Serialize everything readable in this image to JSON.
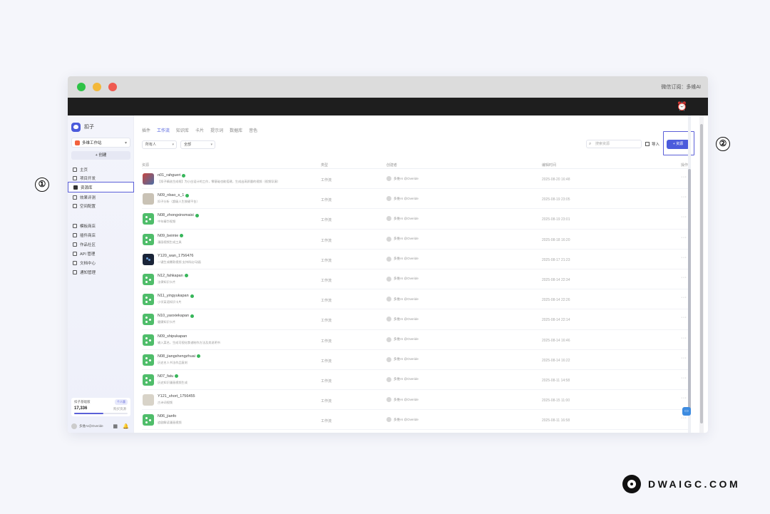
{
  "window": {
    "titlebar_right": "微信订阅：多维AI"
  },
  "sidebar": {
    "brand": "扣子",
    "workspace": "多维工作站",
    "create_label": "+ 创建",
    "items": [
      {
        "label": "主页",
        "icon": "home-icon"
      },
      {
        "label": "项目开发",
        "icon": "code-icon"
      },
      {
        "label": "资源库",
        "icon": "library-icon",
        "active": true
      },
      {
        "label": "效果评测",
        "icon": "chart-icon"
      },
      {
        "label": "空间配置",
        "icon": "settings-icon"
      },
      {
        "label": "模板商店",
        "icon": "template-icon"
      },
      {
        "label": "插件商店",
        "icon": "plugin-icon"
      },
      {
        "label": "作品社区",
        "icon": "community-icon"
      },
      {
        "label": "API 管理",
        "icon": "api-icon"
      },
      {
        "label": "文档中心",
        "icon": "doc-icon"
      },
      {
        "label": "通知管理",
        "icon": "notify-icon"
      }
    ],
    "credits": {
      "title": "扣子基础版",
      "tag": "个人版",
      "value": "17,336",
      "link": "购买资源",
      "progress": 0.55
    },
    "user": {
      "name": "多维AI@Overide"
    }
  },
  "main": {
    "tabs": [
      {
        "label": "插件"
      },
      {
        "label": "工作流",
        "active": true
      },
      {
        "label": "知识库"
      },
      {
        "label": "卡片"
      },
      {
        "label": "提示词"
      },
      {
        "label": "数据库"
      },
      {
        "label": "音色"
      }
    ],
    "filters": {
      "owner": "所有人",
      "status": "全部"
    },
    "search_placeholder": "搜索资源",
    "import_label": "导入",
    "new_label": "+ 资源",
    "columns": {
      "resource": "资源",
      "type": "类型",
      "creator": "创建者",
      "edited": "编辑时间",
      "action": "操作"
    },
    "rows": [
      {
        "name": "n01_rahgueri",
        "desc": "【扣子精选生成框】为小白设计的工作，零基础也能搭建，生成出高质量的视频（视频导演）",
        "type": "工作流",
        "creator": "多维AI @Overide",
        "time": "2025-08-20 16:48",
        "thumb": "img1",
        "ok": true
      },
      {
        "name": "N09_nbao_s_1",
        "desc": "扣子分析（超级人生按键平台）",
        "type": "工作流",
        "creator": "多维AI @Overide",
        "time": "2025-08-19 23:05",
        "thumb": "img2",
        "ok": true
      },
      {
        "name": "N08_zhongxinsmaisi",
        "desc": "中年精华视频",
        "type": "工作流",
        "creator": "多维AI @Overide",
        "time": "2025-08-19 23:01",
        "thumb": "flow",
        "ok": true
      },
      {
        "name": "N09_beimie",
        "desc": "漫画视频生成工具",
        "type": "工作流",
        "creator": "多维AI @Overide",
        "time": "2025-08-18 16:20",
        "thumb": "flow",
        "ok": true
      },
      {
        "name": "Y120_wan_1756476",
        "desc": "一键生成爆款视频 支持科幻/动画",
        "type": "工作流",
        "creator": "多维AI @Overide",
        "time": "2025-08-17 21:23",
        "thumb": "img3",
        "ok": false
      },
      {
        "name": "N12_fahkapan",
        "desc": "法律知识卡片",
        "type": "工作流",
        "creator": "多维AI @Overide",
        "time": "2025-08-14 22:34",
        "thumb": "flow",
        "ok": true
      },
      {
        "name": "N11_yingyukapan",
        "desc": "小学英语知识卡片",
        "type": "工作流",
        "creator": "多维AI @Overide",
        "time": "2025-08-14 22:26",
        "thumb": "flow",
        "ok": true
      },
      {
        "name": "N10_yaoxiekapan",
        "desc": "健康知识卡片",
        "type": "工作流",
        "creator": "多维AI @Overide",
        "time": "2025-08-14 22:14",
        "thumb": "flow",
        "ok": true
      },
      {
        "name": "N09_shipukapan",
        "desc": "输入菜名，生成可视化食谱制作方法及其说明书",
        "type": "工作流",
        "creator": "多维AI @Overide",
        "time": "2025-08-14 16:46",
        "thumb": "flow",
        "ok": false
      },
      {
        "name": "N08_jiangshengzhuai",
        "desc": "历史名人书法作品复刻",
        "type": "工作流",
        "creator": "多维AI @Overide",
        "time": "2025-08-14 16:22",
        "thumb": "flow",
        "ok": true
      },
      {
        "name": "N07_fatu",
        "desc": "历史知识漫画视频生成",
        "type": "工作流",
        "creator": "多维AI @Overide",
        "time": "2025-08-11 14:58",
        "thumb": "flow",
        "ok": true
      },
      {
        "name": "Y121_short_1756455",
        "desc": "古诗词视频",
        "type": "工作流",
        "creator": "多维AI @Overide",
        "time": "2025-08-15 11:00",
        "thumb": "img4",
        "ok": false
      },
      {
        "name": "N06_jianfo",
        "desc": "追剧解读漫画视频",
        "type": "工作流",
        "creator": "多维AI @Overide",
        "time": "2025-08-11 16:58",
        "thumb": "flow",
        "ok": false
      }
    ]
  },
  "annotations": {
    "mark1": "①",
    "mark2": "②"
  },
  "brand": {
    "text": "DWAIGC.COM"
  }
}
